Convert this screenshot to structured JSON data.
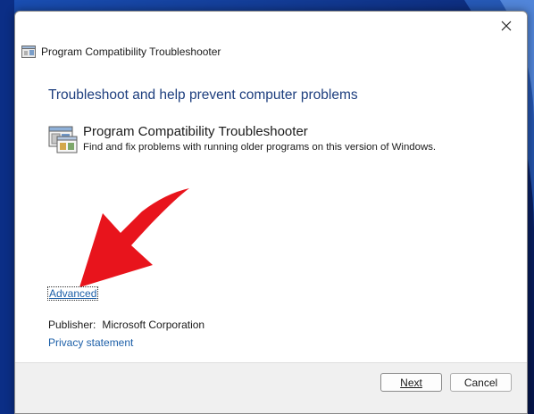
{
  "window": {
    "title": "Program Compatibility Troubleshooter"
  },
  "content": {
    "heading": "Troubleshoot and help prevent computer problems",
    "tool_name": "Program Compatibility Troubleshooter",
    "tool_description": "Find and fix problems with running older programs on this version of Windows.",
    "advanced_label": "Advanced",
    "publisher_label": "Publisher:",
    "publisher_value": "Microsoft Corporation",
    "privacy_label": "Privacy statement"
  },
  "footer": {
    "next_label": "Next",
    "cancel_label": "Cancel"
  },
  "icons": {
    "close": "close-icon",
    "app": "compatibility-troubleshooter-icon",
    "annotation": "red-arrow-icon"
  },
  "colors": {
    "heading": "#1d3e7e",
    "link": "#1c5fa8",
    "annotation_arrow": "#e8141c",
    "footer_bg": "#f0f0f0"
  }
}
